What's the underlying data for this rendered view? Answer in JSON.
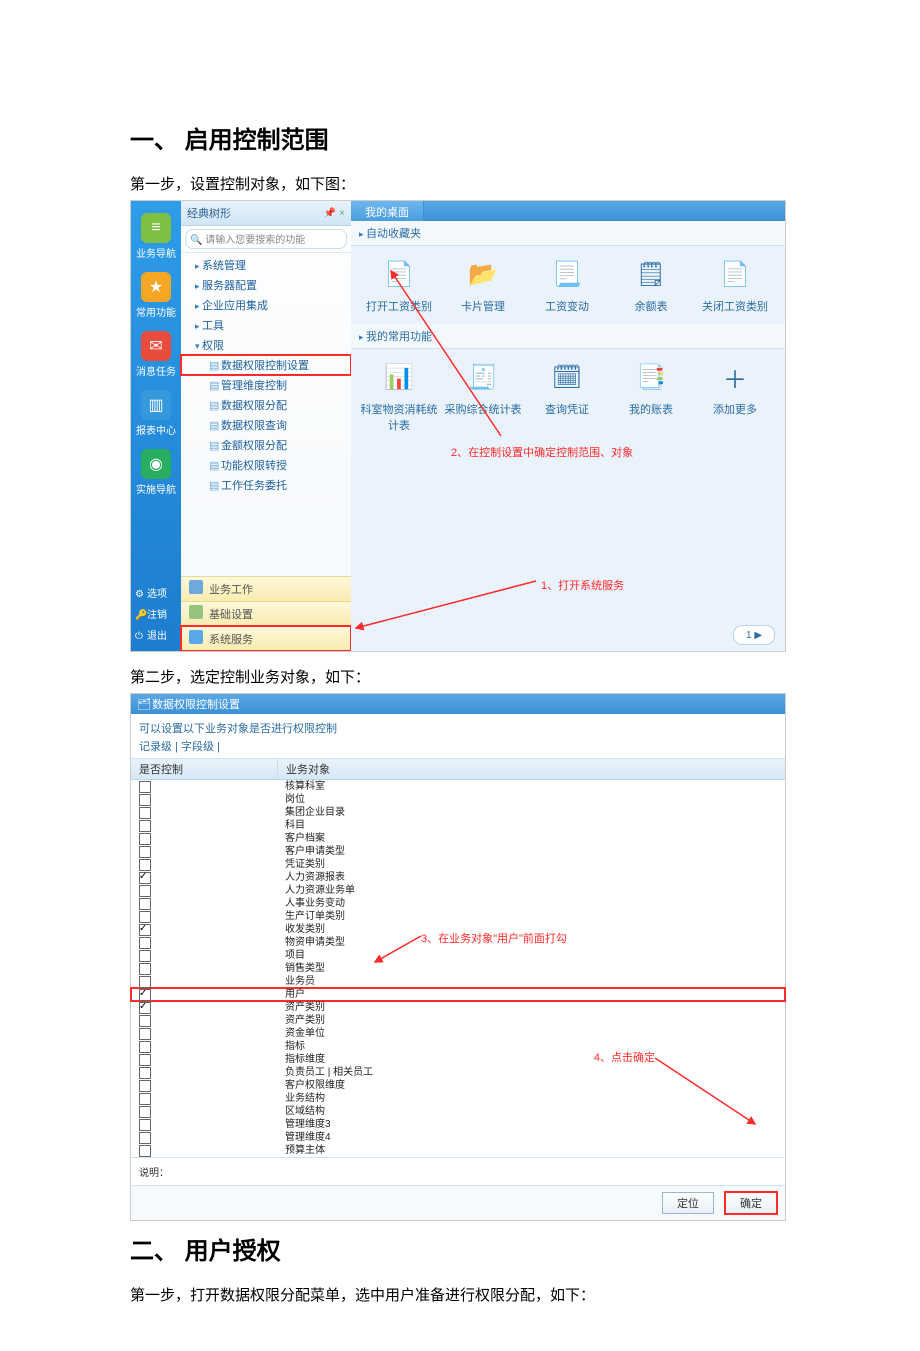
{
  "headings": {
    "section1": "一、 启用控制范围",
    "section2": "二、 用户授权"
  },
  "steps": {
    "s1_step1": "第一步，设置控制对象，如下图：",
    "s1_step2": "第二步，选定控制业务对象，如下：",
    "s2_step1": "第一步，打开数据权限分配菜单，选中用户准备进行权限分配，如下："
  },
  "shot1": {
    "leftbar": {
      "items": [
        {
          "label": "业务导航"
        },
        {
          "label": "常用功能"
        },
        {
          "label": "消息任务"
        },
        {
          "label": "报表中心"
        },
        {
          "label": "实施导航"
        }
      ],
      "bottom": [
        {
          "icon": "⚙",
          "label": "选项"
        },
        {
          "icon": "🔑",
          "label": "注销"
        },
        {
          "icon": "⏻",
          "label": "退出"
        }
      ]
    },
    "tree": {
      "header": "经典树形",
      "pin": "📌 ×",
      "search_placeholder": "请输入您要搜索的功能",
      "nodes": [
        {
          "cls": "lvl1",
          "label": "系统管理"
        },
        {
          "cls": "lvl1",
          "label": "服务器配置"
        },
        {
          "cls": "lvl1",
          "label": "企业应用集成"
        },
        {
          "cls": "lvl1",
          "label": "工具"
        },
        {
          "cls": "lvl1 exp",
          "label": "权限"
        },
        {
          "cls": "lvl2 hl",
          "label": "数据权限控制设置"
        },
        {
          "cls": "lvl2",
          "label": "管理维度控制"
        },
        {
          "cls": "lvl2",
          "label": "数据权限分配"
        },
        {
          "cls": "lvl2",
          "label": "数据权限查询"
        },
        {
          "cls": "lvl2",
          "label": "金额权限分配"
        },
        {
          "cls": "lvl2",
          "label": "功能权限转授"
        },
        {
          "cls": "lvl2",
          "label": "工作任务委托"
        }
      ],
      "bottom_tabs": [
        {
          "label": "业务工作",
          "color": "#6fa8dc"
        },
        {
          "label": "基础设置",
          "color": "#94c47d"
        },
        {
          "label": "系统服务",
          "color": "#5aa9e6",
          "hl": true
        }
      ]
    },
    "main": {
      "tab": "我的桌面",
      "row1_label": "自动收藏夹",
      "row1_items": [
        {
          "label": "打开工资类别",
          "emoji": "📄",
          "bg": "#fff"
        },
        {
          "label": "卡片管理",
          "emoji": "📂",
          "bg": "#fff"
        },
        {
          "label": "工资变动",
          "emoji": "📃",
          "bg": "#fff"
        },
        {
          "label": "余额表",
          "emoji": "🗒",
          "bg": "#fff"
        },
        {
          "label": "关闭工资类别",
          "emoji": "📄",
          "bg": "#fff"
        }
      ],
      "row2_label": "我的常用功能",
      "row2_items": [
        {
          "label": "科室物资消耗统计表",
          "emoji": "📊",
          "bg": "#fff"
        },
        {
          "label": "采购综合统计表",
          "emoji": "🧾",
          "bg": "#fff"
        },
        {
          "label": "查询凭证",
          "emoji": "🗓",
          "bg": "#fff"
        },
        {
          "label": "我的账表",
          "emoji": "📑",
          "bg": "#fff"
        },
        {
          "label": "添加更多",
          "emoji": "＋",
          "bg": "#fff"
        }
      ],
      "annot1": "1、打开系统服务",
      "annot2": "2、在控制设置中确定控制范围、对象",
      "pager": "1"
    }
  },
  "shot2": {
    "title": "数据权限控制设置",
    "desc": "可以设置以下业务对象是否进行权限控制",
    "subtabs": "记录级  | 字段级  |",
    "th1": "是否控制",
    "th2": "业务对象",
    "rows": [
      {
        "checked": false,
        "label": "核算科室"
      },
      {
        "checked": false,
        "label": "岗位"
      },
      {
        "checked": false,
        "label": "集团企业目录"
      },
      {
        "checked": false,
        "label": "科目"
      },
      {
        "checked": false,
        "label": "客户档案"
      },
      {
        "checked": false,
        "label": "客户申请类型"
      },
      {
        "checked": false,
        "label": "凭证类别"
      },
      {
        "checked": true,
        "label": "人力资源报表"
      },
      {
        "checked": false,
        "label": "人力资源业务单"
      },
      {
        "checked": false,
        "label": "人事业务变动"
      },
      {
        "checked": false,
        "label": "生产订单类别"
      },
      {
        "checked": true,
        "label": "收发类别"
      },
      {
        "checked": false,
        "label": "物资申请类型"
      },
      {
        "checked": false,
        "label": "项目"
      },
      {
        "checked": false,
        "label": "销售类型"
      },
      {
        "checked": false,
        "label": "业务员"
      },
      {
        "checked": true,
        "label": "用户",
        "hl": true
      },
      {
        "checked": true,
        "label": "资产类别"
      },
      {
        "checked": false,
        "label": "资产类别"
      },
      {
        "checked": false,
        "label": "资金单位"
      },
      {
        "checked": false,
        "label": "指标"
      },
      {
        "checked": false,
        "label": "指标维度"
      },
      {
        "checked": false,
        "label": "负责员工 | 相关员工"
      },
      {
        "checked": false,
        "label": "客户权限维度"
      },
      {
        "checked": false,
        "label": "业务结构"
      },
      {
        "checked": false,
        "label": "区域结构"
      },
      {
        "checked": false,
        "label": "管理维度3"
      },
      {
        "checked": false,
        "label": "管理维度4"
      },
      {
        "checked": false,
        "label": "预算主体"
      }
    ],
    "expl_label": "说明：",
    "annot3": "3、在业务对象\"用户\"前面打勾",
    "annot4": "4、点击确定",
    "btn_locate": "定位",
    "btn_ok": "确定"
  }
}
